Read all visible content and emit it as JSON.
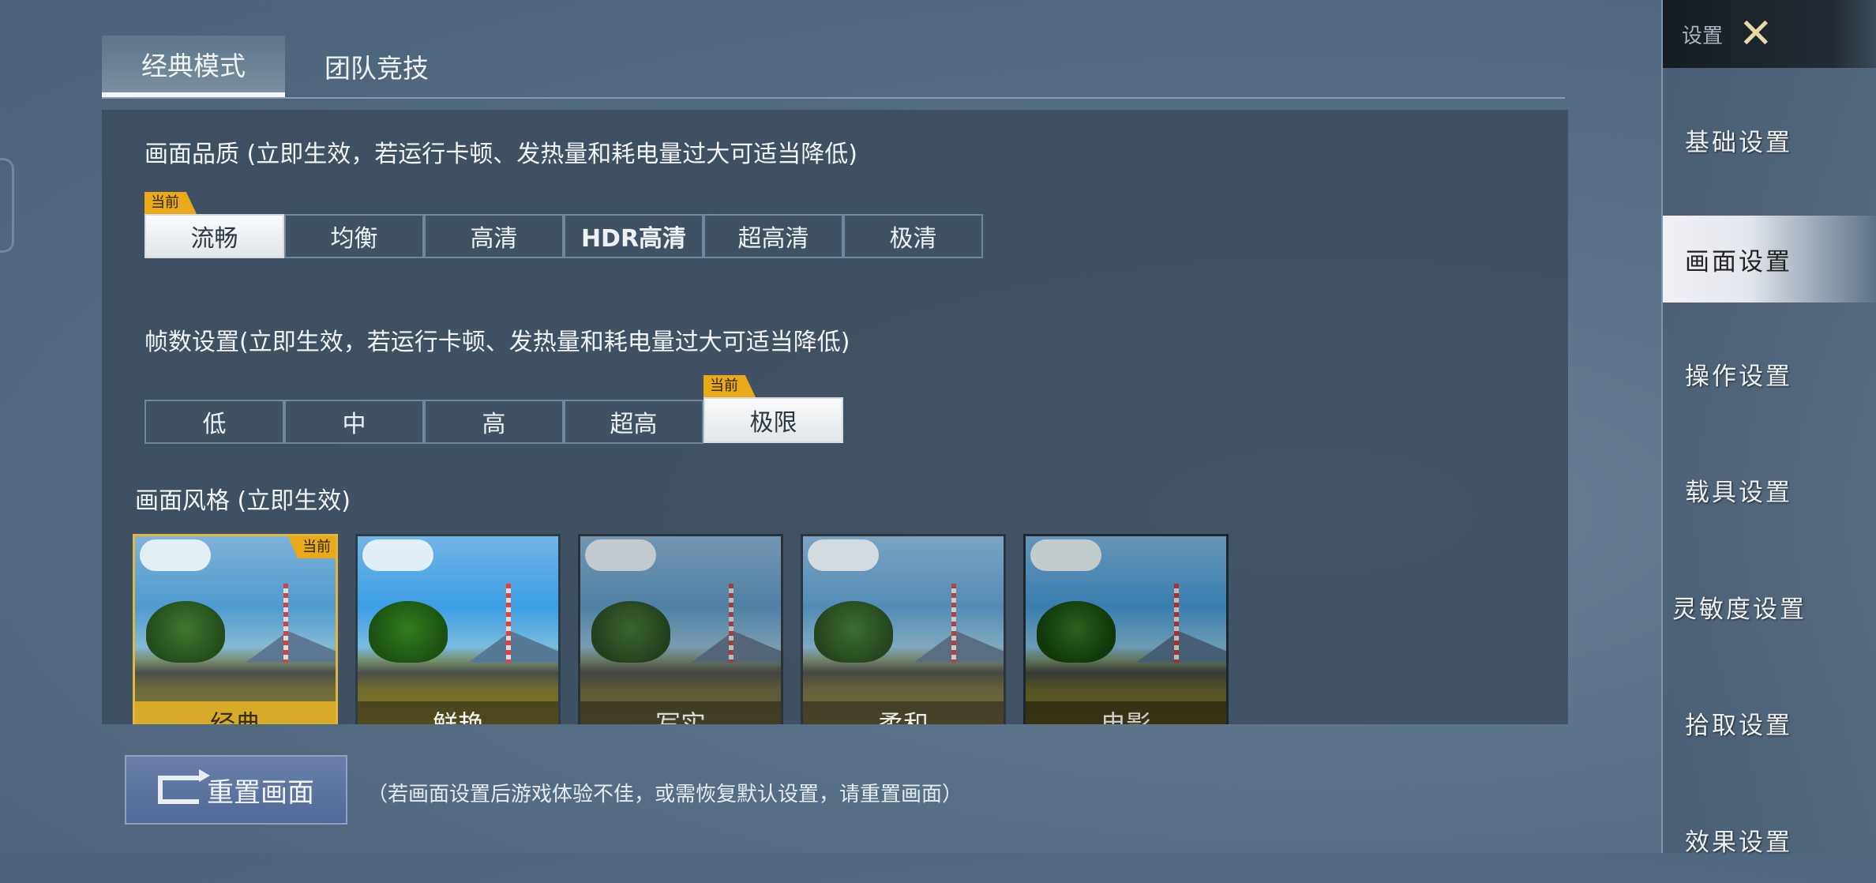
{
  "tabs": [
    {
      "label": "经典模式",
      "active": true
    },
    {
      "label": "团队竞技",
      "active": false
    }
  ],
  "quality": {
    "title": "画面品质 (立即生效，若运行卡顿、发热量和耗电量过大可适当降低)",
    "current_badge": "当前",
    "options": [
      "流畅",
      "均衡",
      "高清",
      "HDR高清",
      "超高清",
      "极清"
    ],
    "selected": "流畅"
  },
  "fps": {
    "title": "帧数设置(立即生效，若运行卡顿、发热量和耗电量过大可适当降低)",
    "current_badge": "当前",
    "options": [
      "低",
      "中",
      "高",
      "超高",
      "极限"
    ],
    "selected": "极限"
  },
  "style": {
    "title": "画面风格 (立即生效)",
    "current_badge": "当前",
    "options": [
      "经典",
      "鲜艳",
      "写实",
      "柔和",
      "电影"
    ],
    "selected": "经典"
  },
  "reset": {
    "label": "重置画面",
    "hint": "（若画面设置后游戏体验不佳，或需恢复默认设置，请重置画面）"
  },
  "sidebar": {
    "title": "设置",
    "close_icon": "close-x-icon",
    "items": [
      "基础设置",
      "画面设置",
      "操作设置",
      "载具设置",
      "灵敏度设置",
      "拾取设置",
      "效果设置"
    ],
    "active": "画面设置"
  },
  "colors": {
    "accent": "#e9a91a",
    "selected_bg": "#f4f6f8"
  }
}
